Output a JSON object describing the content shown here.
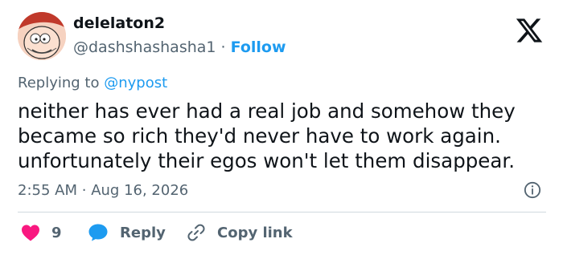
{
  "author": {
    "display_name": "delelaton2",
    "handle": "@dashshashasha1",
    "separator": "·",
    "follow_label": "Follow"
  },
  "reply_context": {
    "prefix": "Replying to",
    "mention": "@nypost"
  },
  "tweet": {
    "line1": "neither has ever had a real job and somehow they",
    "line2": "became so rich they'd never have to work again.",
    "line3": "unfortunately their egos won't let them disappear."
  },
  "timestamp": {
    "time": "2:55 AM",
    "separator": "·",
    "date": "Aug 16, 2026"
  },
  "actions": {
    "like_count": "9",
    "reply_label": "Reply",
    "copy_link_label": "Copy link"
  },
  "colors": {
    "accent": "#1d9bf0",
    "like": "#f91880",
    "muted": "#536471",
    "text": "#0f1419"
  },
  "icons": {
    "brand": "x-logo-icon",
    "like": "heart-icon",
    "reply": "speech-bubble-icon",
    "copy_link": "link-icon",
    "info": "info-icon"
  }
}
